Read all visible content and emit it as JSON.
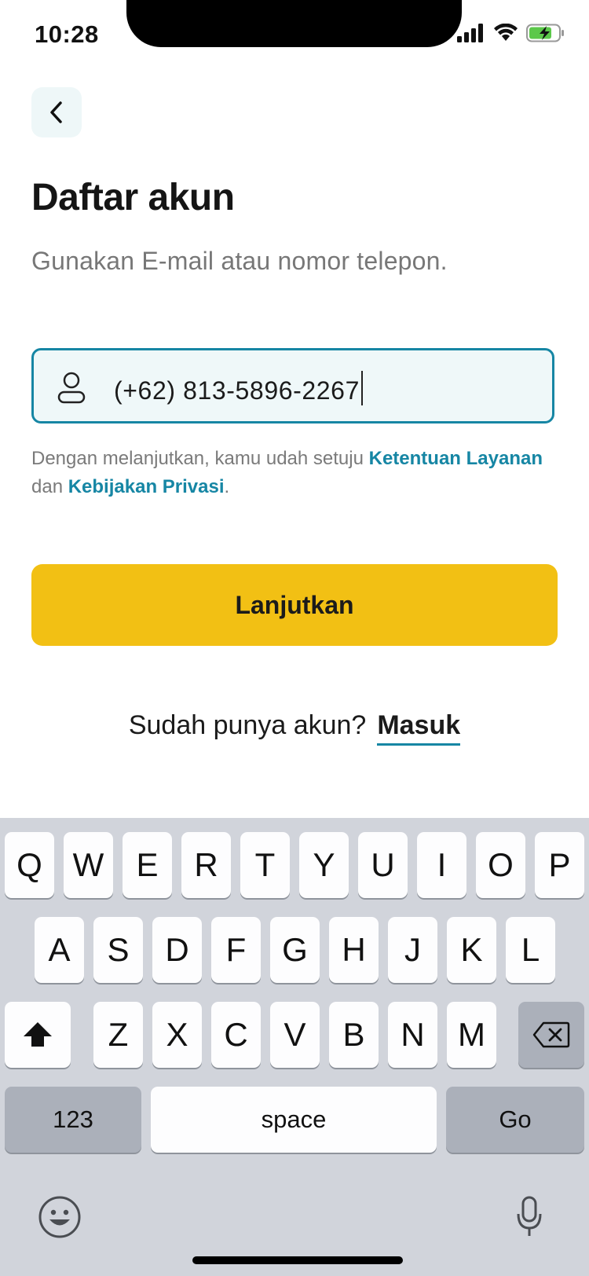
{
  "status_bar": {
    "time": "10:28"
  },
  "header": {
    "title": "Daftar akun",
    "subtitle": "Gunakan E-mail atau nomor telepon."
  },
  "input": {
    "value": "(+62) 813-5896-2267"
  },
  "terms": {
    "prefix": "Dengan melanjutkan, kamu udah setuju ",
    "link1": "Ketentuan Layanan",
    "middle": " dan ",
    "link2": "Kebijakan Privasi",
    "suffix": "."
  },
  "primary_button": {
    "label": "Lanjutkan"
  },
  "login": {
    "prompt": "Sudah punya akun?",
    "link": "Masuk"
  },
  "keyboard": {
    "row1": [
      "Q",
      "W",
      "E",
      "R",
      "T",
      "Y",
      "U",
      "I",
      "O",
      "P"
    ],
    "row2": [
      "A",
      "S",
      "D",
      "F",
      "G",
      "H",
      "J",
      "K",
      "L"
    ],
    "row3": [
      "Z",
      "X",
      "C",
      "V",
      "B",
      "N",
      "M"
    ],
    "numbers_key": "123",
    "space_key": "space",
    "go_key": "Go"
  },
  "colors": {
    "accent": "#1686a4",
    "primary_button": "#f2c014",
    "input_background": "#eff8f9",
    "back_button_background": "#eef7f8",
    "keyboard_background": "#d1d4db"
  },
  "icons": {
    "back": "chevron-left-icon",
    "input": "user-icon",
    "shift": "shift-icon",
    "delete": "backspace-icon",
    "emoji": "emoji-icon",
    "mic": "microphone-icon"
  }
}
